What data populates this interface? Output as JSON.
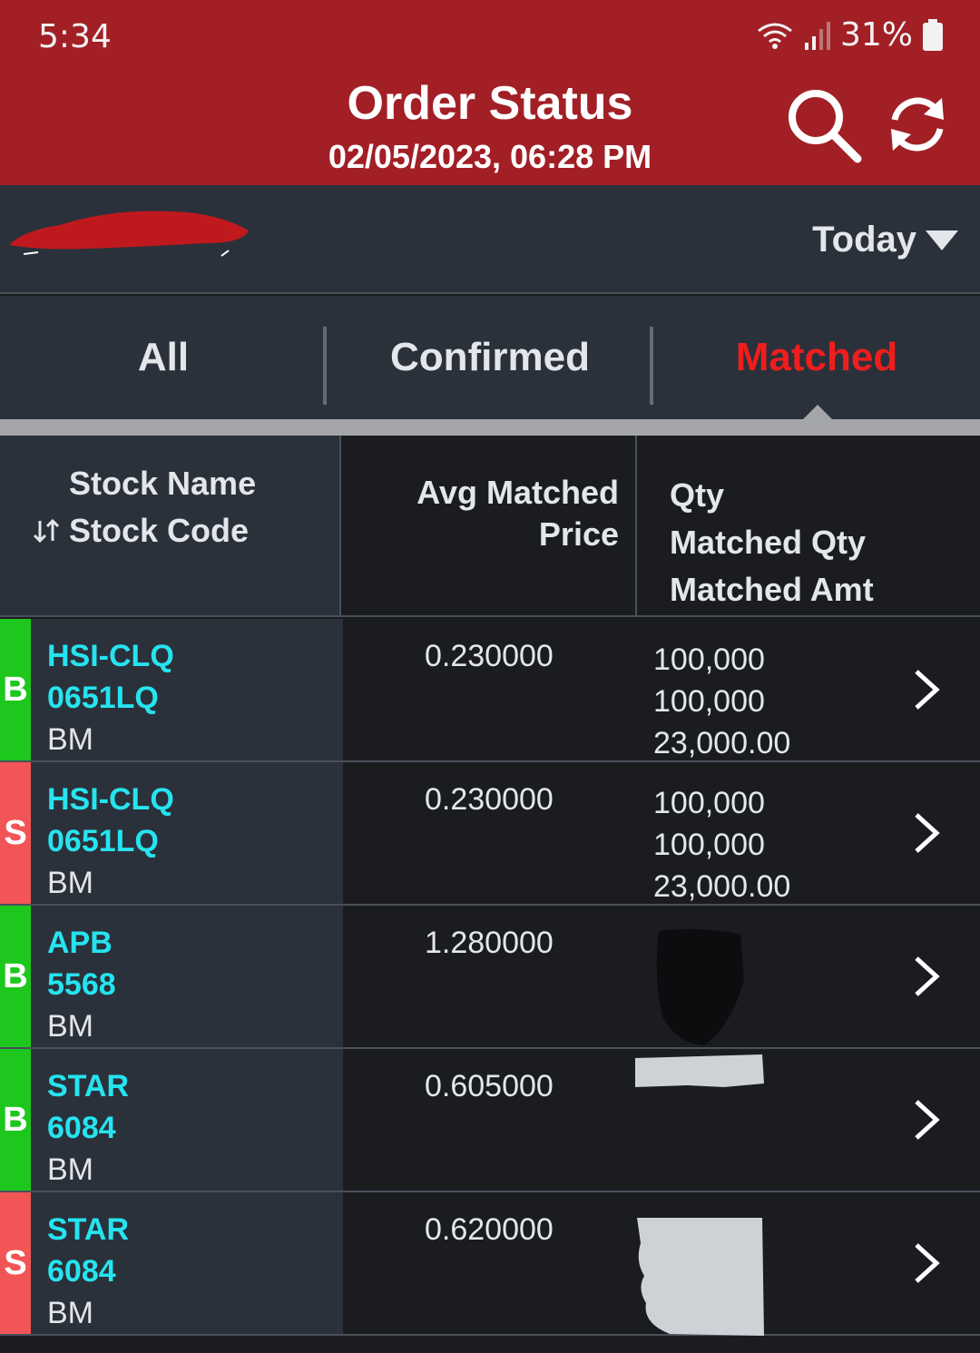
{
  "status_bar": {
    "time": "5:34",
    "battery": "31%"
  },
  "header": {
    "title": "Order Status",
    "datetime": "02/05/2023, 06:28 PM"
  },
  "filter": {
    "label": "Today"
  },
  "tabs": [
    {
      "label": "All",
      "active": false
    },
    {
      "label": "Confirmed",
      "active": false
    },
    {
      "label": "Matched",
      "active": true
    }
  ],
  "table_header": {
    "stock_name": "Stock Name",
    "stock_code": "Stock Code",
    "avg_price_line1": "Avg Matched",
    "avg_price_line2": "Price",
    "qty": "Qty",
    "matched_qty": "Matched Qty",
    "matched_amt": "Matched Amt"
  },
  "rows": [
    {
      "side": "B",
      "name": "HSI-CLQ",
      "code": "0651LQ",
      "market": "BM",
      "price": "0.230000",
      "qty": "100,000",
      "matched_qty": "100,000",
      "matched_amt": "23,000.00"
    },
    {
      "side": "S",
      "name": "HSI-CLQ",
      "code": "0651LQ",
      "market": "BM",
      "price": "0.230000",
      "qty": "100,000",
      "matched_qty": "100,000",
      "matched_amt": "23,000.00"
    },
    {
      "side": "B",
      "name": "APB",
      "code": "5568",
      "market": "BM",
      "price": "1.280000",
      "qty": "",
      "matched_qty": "",
      "matched_amt": ""
    },
    {
      "side": "B",
      "name": "STAR",
      "code": "6084",
      "market": "BM",
      "price": "0.605000",
      "qty": "",
      "matched_qty": "",
      "matched_amt": ""
    },
    {
      "side": "S",
      "name": "STAR",
      "code": "6084",
      "market": "BM",
      "price": "0.620000",
      "qty": "",
      "matched_qty": "",
      "matched_amt": ""
    }
  ],
  "colors": {
    "header_bg": "#a21f26",
    "buy": "#1ec71e",
    "sell": "#f25555",
    "stock_text": "#25e4ef",
    "active_tab": "#f01d1d"
  }
}
